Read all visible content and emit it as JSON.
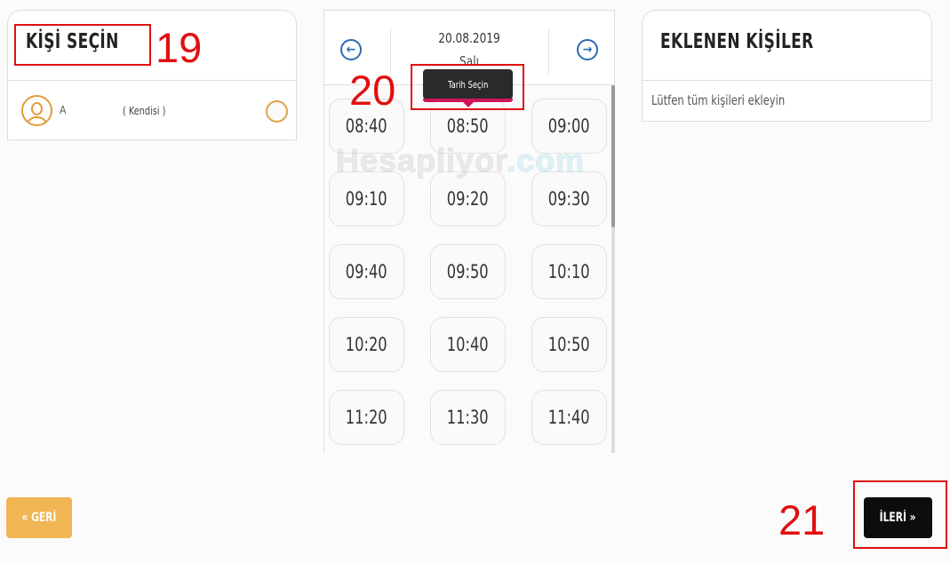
{
  "left_panel": {
    "title": "KİŞİ SEÇİN",
    "person": {
      "name": "A",
      "relation": "( Kendisi )",
      "selected": false
    }
  },
  "date_panel": {
    "date": "20.08.2019",
    "day": "Salı",
    "prev_icon": "arrow-left-circle",
    "next_icon": "arrow-right-circle",
    "tooltip": "Tarih Seçin"
  },
  "time_slots": [
    "08:40",
    "08:50",
    "09:00",
    "09:10",
    "09:20",
    "09:30",
    "09:40",
    "09:50",
    "10:10",
    "10:20",
    "10:40",
    "10:50",
    "11:20",
    "11:30",
    "11:40"
  ],
  "right_panel": {
    "title": "EKLENEN KİŞİLER",
    "hint": "Lütfen tüm kişileri ekleyin"
  },
  "buttons": {
    "back": "« GERİ",
    "next": "İLERİ »"
  },
  "annotations": {
    "n19": "19",
    "n20": "20",
    "n21": "21"
  },
  "watermark": {
    "part1": "Hesapliyor",
    "part2": ".com"
  },
  "colors": {
    "accent_orange": "#f2b553",
    "nav_blue": "#2a6bb1",
    "annotation_red": "#e01010",
    "tooltip_pink": "#d0145a"
  }
}
